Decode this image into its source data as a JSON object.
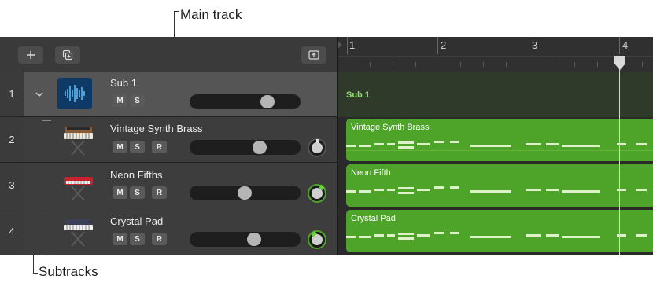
{
  "annotations": {
    "main_track": "Main track",
    "subtracks": "Subtracks"
  },
  "toolbar": {
    "add_icon": "plus-icon",
    "duplicate_icon": "duplicate-icon",
    "upload_icon": "upload-icon"
  },
  "ruler": {
    "bars": [
      "1",
      "2",
      "3",
      "4"
    ]
  },
  "tracks": [
    {
      "number": "1",
      "name": "Sub 1",
      "buttons": [
        "M",
        "S"
      ],
      "volume": 0.8,
      "region": "Sub 1",
      "instrument": "waveform-icon"
    },
    {
      "number": "2",
      "name": "Vintage Synth Brass",
      "buttons": [
        "M",
        "S",
        "R"
      ],
      "volume": 0.7,
      "region": "Vintage Synth Brass",
      "instrument": "synth-keyboard-icon"
    },
    {
      "number": "3",
      "name": "Neon Fifths",
      "buttons": [
        "M",
        "S",
        "R"
      ],
      "volume": 0.5,
      "region": "Neon Fifth",
      "instrument": "red-synth-icon"
    },
    {
      "number": "4",
      "name": "Crystal Pad",
      "buttons": [
        "M",
        "S",
        "R"
      ],
      "volume": 0.6,
      "region": "Crystal Pad",
      "instrument": "pad-synth-icon"
    }
  ],
  "colors": {
    "region": "#4ea428",
    "playhead": "#d8d8d8",
    "summing_row": "#555555"
  }
}
